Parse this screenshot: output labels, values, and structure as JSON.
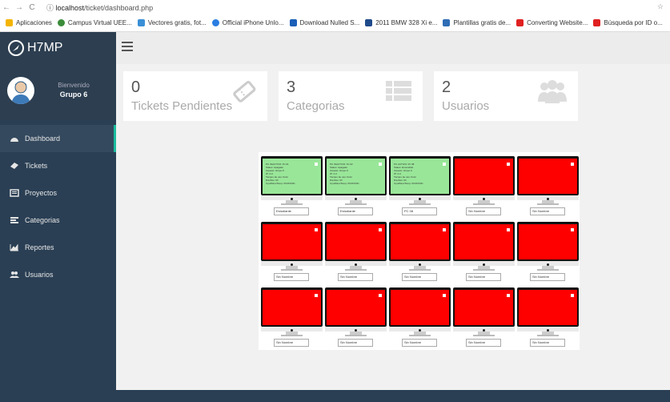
{
  "browser": {
    "url_host": "localhost",
    "url_path": "/ticket/dashboard.php",
    "bookmarks": [
      {
        "label": "Aplicaciones",
        "color": "#f4b400"
      },
      {
        "label": "Campus Virtual UEE...",
        "color": "#3b8c3b"
      },
      {
        "label": "Vectores gratis, fot...",
        "color": "#3a8fd6"
      },
      {
        "label": "Official iPhone Unlo...",
        "color": "#2a7de1"
      },
      {
        "label": "Download Nulled S...",
        "color": "#1b5fb8"
      },
      {
        "label": "2011 BMW 328 Xi e...",
        "color": "#1f4a8a"
      },
      {
        "label": "Plantillas gratis de...",
        "color": "#2f6db5"
      },
      {
        "label": "Converting Website...",
        "color": "#e02020"
      },
      {
        "label": "Búsqueda por ID o...",
        "color": "#e02020"
      }
    ]
  },
  "app": {
    "brand": "H7MP",
    "welcome": "Bienvenido",
    "user": "Grupo 6"
  },
  "nav": [
    {
      "label": "Dashboard",
      "icon": "dashboard-icon"
    },
    {
      "label": "Tickets",
      "icon": "ticket-icon"
    },
    {
      "label": "Proyectos",
      "icon": "projects-icon"
    },
    {
      "label": "Categorias",
      "icon": "categories-icon"
    },
    {
      "label": "Reportes",
      "icon": "reports-icon"
    },
    {
      "label": "Usuarios",
      "icon": "users-icon"
    }
  ],
  "cards": [
    {
      "value": "0",
      "label": "Tickets Pendientes",
      "icon": "ticket-icon"
    },
    {
      "value": "3",
      "label": "Categorias",
      "icon": "list-icon"
    },
    {
      "value": "2",
      "label": "Usuarios",
      "icon": "users-icon"
    }
  ],
  "colors": {
    "sidebar": "#2a3f54",
    "accent": "#1abb9c",
    "online": "#99e699",
    "offline": "#ff0000"
  },
  "monitors": [
    {
      "status": "online",
      "name": "Estudiante",
      "info": [
        "PC INACTIVO: Pc 01",
        "Status: Apagado",
        "Usuario: Grupo 6",
        "IP: 2.0",
        "Tiempo de uso: 0min",
        "Dia Res: 0h",
        "Cpu/Ram/Temp: 0%/0%/0C"
      ]
    },
    {
      "status": "online",
      "name": "Estudiante",
      "info": [
        "PC INACTIVO: Pc 02",
        "Status: Apagado",
        "Usuario: Grupo 6",
        "IP: 2.0",
        "Tiempo de uso: 0min",
        "Dia Res: 0h",
        "Cpu/Ram/Temp: 0%/0%/0C"
      ]
    },
    {
      "status": "online",
      "name": "PC 08",
      "info": [
        "PC ACTIVO: Pc 08",
        "Status: Encendido",
        "Usuario: Grupo 6",
        "IP: 2.0",
        "Tiempo de uso: 0min",
        "Dia Res: 0h",
        "Cpu/Ram/Temp: 0%/0%/0C"
      ]
    },
    {
      "status": "offline",
      "name": "Sin Nombre",
      "info": []
    },
    {
      "status": "offline",
      "name": "Sin Nombre",
      "info": []
    },
    {
      "status": "offline",
      "name": "Sin Nombre",
      "info": []
    },
    {
      "status": "offline",
      "name": "Sin Nombre",
      "info": []
    },
    {
      "status": "offline",
      "name": "Sin Nombre",
      "info": []
    },
    {
      "status": "offline",
      "name": "Sin Nombre",
      "info": []
    },
    {
      "status": "offline",
      "name": "Sin Nombre",
      "info": []
    },
    {
      "status": "offline",
      "name": "Sin Nombre",
      "info": []
    },
    {
      "status": "offline",
      "name": "Sin Nombre",
      "info": []
    },
    {
      "status": "offline",
      "name": "Sin Nombre",
      "info": []
    },
    {
      "status": "offline",
      "name": "Sin Nombre",
      "info": []
    },
    {
      "status": "offline",
      "name": "Sin Nombre",
      "info": []
    }
  ]
}
